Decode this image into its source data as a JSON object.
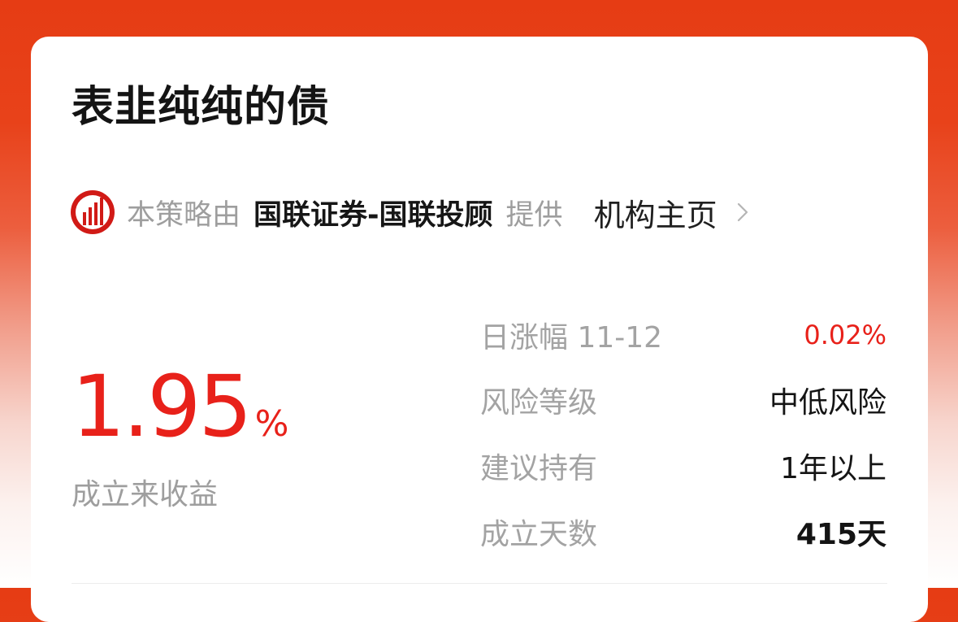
{
  "card": {
    "title": "表韭纯纯的债"
  },
  "provider": {
    "prefix": "本策略由",
    "name": "国联证券-国联投顾",
    "suffix": "提供",
    "org_link_label": "机构主页",
    "logo_icon": "guolian-logo-icon",
    "chevron_icon": "chevron-right-icon"
  },
  "performance": {
    "return_value": "1.95",
    "return_unit": "%",
    "return_label": "成立来收益"
  },
  "stats": [
    {
      "label": "日涨幅 11-12",
      "value": "0.02%",
      "color": "#e8211a"
    },
    {
      "label": "风险等级",
      "value": "中低风险"
    },
    {
      "label": "建议持有",
      "value": "1年以上"
    },
    {
      "label": "成立天数",
      "value": "415天"
    }
  ],
  "colors": {
    "accent": "#e8211a",
    "header_bg": "#e63c14",
    "muted_text": "#9e9e9e"
  }
}
